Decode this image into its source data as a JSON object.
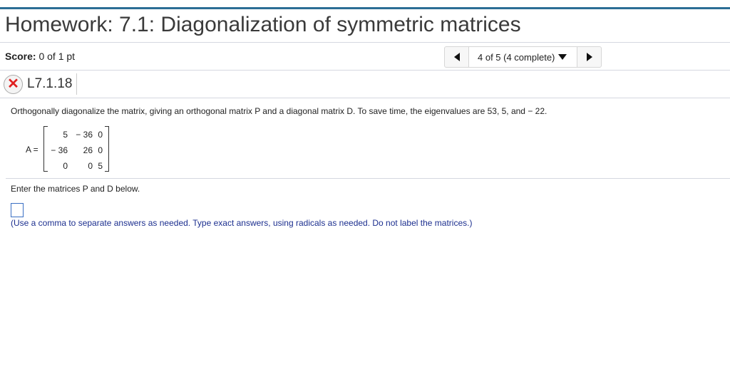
{
  "header": {
    "title": "Homework: 7.1: Diagonalization of symmetric matrices"
  },
  "score": {
    "label": "Score:",
    "value": "0 of 1 pt"
  },
  "nav": {
    "progress": "4 of 5 (4 complete)",
    "prev_icon": "left-triangle",
    "next_icon": "right-triangle",
    "dropdown_icon": "down-triangle"
  },
  "question": {
    "id": "L7.1.18",
    "status_icon": "red-x",
    "prompt": "Orthogonally diagonalize the matrix, giving an orthogonal matrix P and a diagonal matrix D. To save time, the eigenvalues are 53, 5, and − 22.",
    "matrix_label": "A =",
    "matrix": [
      [
        "5",
        "− 36",
        "0"
      ],
      [
        "− 36",
        "26",
        "0"
      ],
      [
        "0",
        "0",
        "5"
      ]
    ],
    "instruction": "Enter the matrices P and D below.",
    "answer_value": "",
    "hint": "(Use a comma to separate answers as needed. Type exact answers, using radicals as needed. Do not label the matrices.)"
  },
  "colors": {
    "accent": "#2c6e95",
    "error": "#e02020",
    "hint": "#1c2f8f"
  }
}
